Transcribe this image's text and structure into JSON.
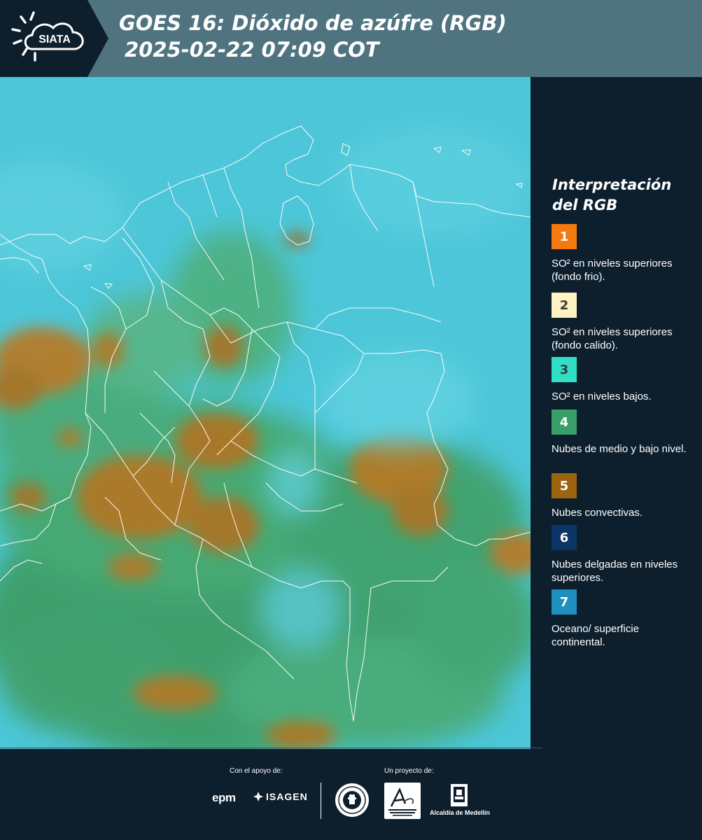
{
  "header": {
    "logo_text": "SIATA",
    "title_line1": "GOES 16: Dióxido de azúfre (RGB)",
    "title_line2": "2025-02-22 07:09 COT"
  },
  "legend": {
    "title": "Interpretación del RGB",
    "items": [
      {
        "num": "1",
        "label": "SO² en niveles superiores (fondo frio).",
        "color": "#f47a10",
        "text_color": "#ffffff"
      },
      {
        "num": "2",
        "label": "SO² en niveles superiores (fondo calido).",
        "color": "#fff2c3",
        "text_color": "#3b3b3b"
      },
      {
        "num": "3",
        "label": "SO² en niveles bajos.",
        "color": "#2fe0c6",
        "text_color": "#3b3b3b"
      },
      {
        "num": "4",
        "label": "Nubes de medio y bajo nivel.",
        "color": "#3a9e6a",
        "text_color": "#ffffff"
      },
      {
        "num": "5",
        "label": "Nubes convectivas.",
        "color": "#9d6410",
        "text_color": "#ffffff"
      },
      {
        "num": "6",
        "label": "Nubes delgadas en niveles superiores.",
        "color": "#0b3566",
        "text_color": "#ffffff"
      },
      {
        "num": "7",
        "label": "Oceano/ superficie continental.",
        "color": "#1f8fbd",
        "text_color": "#ffffff"
      }
    ]
  },
  "footer": {
    "support_label": "Con el apoyo de:",
    "project_label": "Un proyecto de:",
    "epm": "epm",
    "isagen": "ISAGEN",
    "alcaldia": "Alcaldía de Medellín"
  }
}
